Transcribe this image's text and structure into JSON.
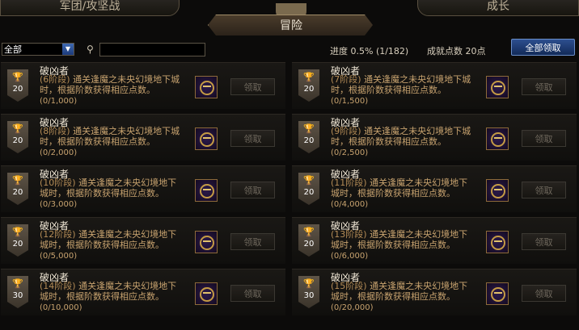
{
  "tabs": {
    "left": "军团/攻坚战",
    "center": "冒险",
    "right": "成长"
  },
  "filter": {
    "selected": "全部"
  },
  "search": {
    "placeholder": ""
  },
  "stats": {
    "progress": "进度  0.5% (1/182)",
    "points": "成就点数 20点"
  },
  "claim_all": "全部领取",
  "achievements": [
    {
      "title": "破凶者",
      "stage": "(6阶段)",
      "desc": "通关逢魔之未央幻境地下城时，根据阶数获得相应点数。",
      "count": "(0/1,000)",
      "points": "20",
      "claim": "领取"
    },
    {
      "title": "破凶者",
      "stage": "(7阶段)",
      "desc": "通关逢魔之未央幻境地下城时，根据阶数获得相应点数。",
      "count": "(0/1,500)",
      "points": "20",
      "claim": "领取"
    },
    {
      "title": "破凶者",
      "stage": "(8阶段)",
      "desc": "通关逢魔之未央幻境地下城时，根据阶数获得相应点数。",
      "count": "(0/2,000)",
      "points": "20",
      "claim": "领取"
    },
    {
      "title": "破凶者",
      "stage": "(9阶段)",
      "desc": "通关逢魔之未央幻境地下城时，根据阶数获得相应点数。",
      "count": "(0/2,500)",
      "points": "20",
      "claim": "领取"
    },
    {
      "title": "破凶者",
      "stage": "(10阶段)",
      "desc": "通关逢魔之未央幻境地下城时，根据阶数获得相应点数。",
      "count": "(0/3,000)",
      "points": "20",
      "claim": "领取"
    },
    {
      "title": "破凶者",
      "stage": "(11阶段)",
      "desc": "通关逢魔之未央幻境地下城时，根据阶数获得相应点数。",
      "count": "(0/4,000)",
      "points": "20",
      "claim": "领取"
    },
    {
      "title": "破凶者",
      "stage": "(12阶段)",
      "desc": "通关逢魔之未央幻境地下城时，根据阶数获得相应点数。",
      "count": "(0/5,000)",
      "points": "20",
      "claim": "领取"
    },
    {
      "title": "破凶者",
      "stage": "(13阶段)",
      "desc": "通关逢魔之未央幻境地下城时，根据阶数获得相应点数。",
      "count": "(0/6,000)",
      "points": "20",
      "claim": "领取"
    },
    {
      "title": "破凶者",
      "stage": "(14阶段)",
      "desc": "通关逢魔之未央幻境地下城时，根据阶数获得相应点数。",
      "count": "(0/10,000)",
      "points": "30",
      "claim": "领取"
    },
    {
      "title": "破凶者",
      "stage": "(15阶段)",
      "desc": "通关逢魔之未央幻境地下城时，根据阶数获得相应点数。",
      "count": "(0/20,000)",
      "points": "30",
      "claim": "领取"
    }
  ]
}
